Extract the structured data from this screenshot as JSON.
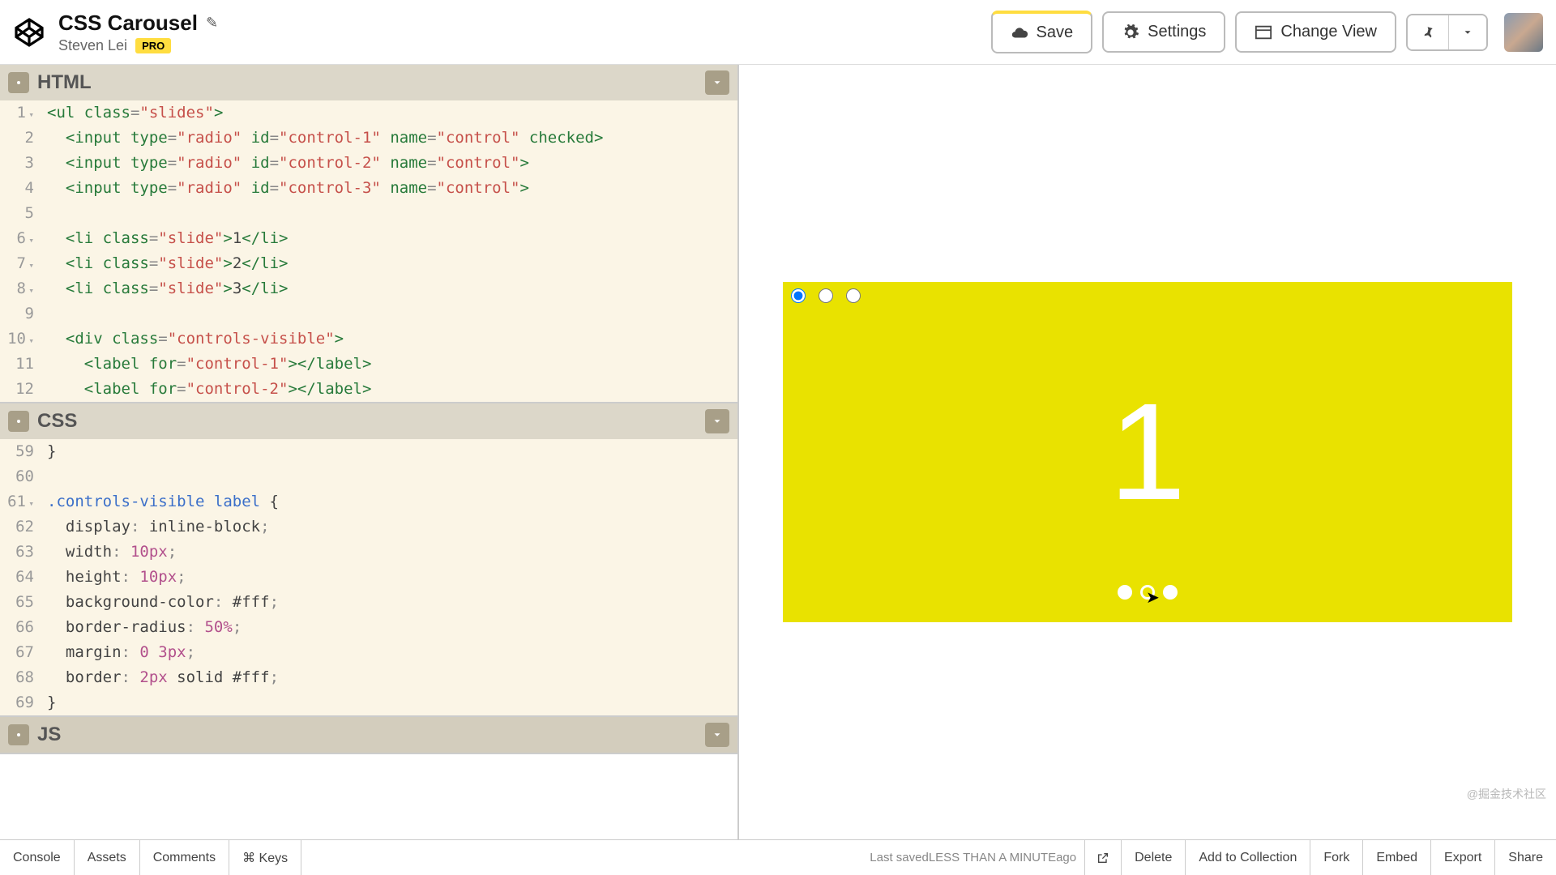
{
  "header": {
    "title": "CSS Carousel",
    "author": "Steven Lei",
    "badge": "PRO"
  },
  "toolbar": {
    "save": "Save",
    "settings": "Settings",
    "change_view": "Change View"
  },
  "panels": {
    "html": {
      "title": "HTML"
    },
    "css": {
      "title": "CSS"
    },
    "js": {
      "title": "JS"
    }
  },
  "html_code": {
    "lines": [
      1,
      2,
      3,
      4,
      5,
      6,
      7,
      8,
      9,
      10,
      11,
      12
    ],
    "folds": [
      1,
      6,
      7,
      8,
      10
    ],
    "l1": {
      "tag_open": "<ul",
      "attr": " class",
      "eq": "=",
      "str": "\"slides\"",
      "close": ">"
    },
    "l2": {
      "tag_open": "  <input",
      "a1": " type",
      "s1": "\"radio\"",
      "a2": " id",
      "s2": "\"control-1\"",
      "a3": " name",
      "s3": "\"control\"",
      "ck": " checked",
      "close": ">"
    },
    "l3": {
      "tag_open": "  <input",
      "a1": " type",
      "s1": "\"radio\"",
      "a2": " id",
      "s2": "\"control-2\"",
      "a3": " name",
      "s3": "\"control\"",
      "close": ">"
    },
    "l4": {
      "tag_open": "  <input",
      "a1": " type",
      "s1": "\"radio\"",
      "a2": " id",
      "s2": "\"control-3\"",
      "a3": " name",
      "s3": "\"control\"",
      "close": ">"
    },
    "l6": {
      "tag_open": "  <li",
      "attr": " class",
      "s": "\"slide\"",
      "close": ">",
      "txt": "1",
      "end": "</li>"
    },
    "l7": {
      "tag_open": "  <li",
      "attr": " class",
      "s": "\"slide\"",
      "close": ">",
      "txt": "2",
      "end": "</li>"
    },
    "l8": {
      "tag_open": "  <li",
      "attr": " class",
      "s": "\"slide\"",
      "close": ">",
      "txt": "3",
      "end": "</li>"
    },
    "l10": {
      "tag_open": "  <div",
      "attr": " class",
      "s": "\"controls-visible\"",
      "close": ">"
    },
    "l11": {
      "tag_open": "    <label",
      "attr": " for",
      "s": "\"control-1\"",
      "close": ">",
      "end": "</label>"
    },
    "l12": {
      "tag_open": "    <label",
      "attr": " for",
      "s": "\"control-2\"",
      "close": ">",
      "end": "</label>"
    }
  },
  "css_code": {
    "lines": [
      59,
      60,
      61,
      62,
      63,
      64,
      65,
      66,
      67,
      68,
      69
    ],
    "fold_line": 61,
    "l59": "}",
    "l61": {
      "sel": ".controls-visible label",
      "open": " {"
    },
    "l62": {
      "prop": "  display",
      "val": "inline-block"
    },
    "l63": {
      "prop": "  width",
      "num": "10px"
    },
    "l64": {
      "prop": "  height",
      "num": "10px"
    },
    "l65": {
      "prop": "  background-color",
      "val": "#fff"
    },
    "l66": {
      "prop": "  border-radius",
      "num": "50%"
    },
    "l67": {
      "prop": "  margin",
      "num": "0 3px"
    },
    "l68": {
      "prop": "  border",
      "num": "2px",
      "val": " solid #fff"
    },
    "l69": "}"
  },
  "preview": {
    "slide_number": "1"
  },
  "footer": {
    "console": "Console",
    "assets": "Assets",
    "comments": "Comments",
    "keys": "⌘ Keys",
    "saved_prefix": "Last saved ",
    "saved_em": "LESS THAN A MINUTE",
    "saved_suffix": " ago",
    "delete": "Delete",
    "add": "Add to Collection",
    "fork": "Fork",
    "embed": "Embed",
    "export": "Export",
    "share": "Share"
  },
  "watermark": "@掘金技术社区"
}
